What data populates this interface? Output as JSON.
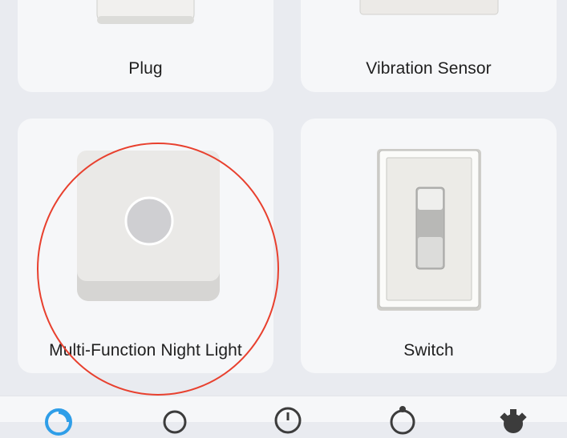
{
  "devices": [
    {
      "label": "Plug",
      "icon": "plug-device-icon"
    },
    {
      "label": "Vibration Sensor",
      "icon": "vibration-sensor-icon"
    },
    {
      "label": "Multi-Function Night Light",
      "icon": "night-light-icon"
    },
    {
      "label": "Switch",
      "icon": "light-switch-icon"
    }
  ],
  "bottom_nav": [
    {
      "icon": "home-icon",
      "active": true
    },
    {
      "icon": "search-icon",
      "active": false
    },
    {
      "icon": "clock-icon",
      "active": false
    },
    {
      "icon": "automation-icon",
      "active": false
    },
    {
      "icon": "settings-icon",
      "active": false
    }
  ],
  "colors": {
    "background": "#e9ebf0",
    "card": "#f6f7f9",
    "accent": "#2f9ee8",
    "annotation": "#e8402e",
    "nav_icon": "#3c3c3c"
  }
}
